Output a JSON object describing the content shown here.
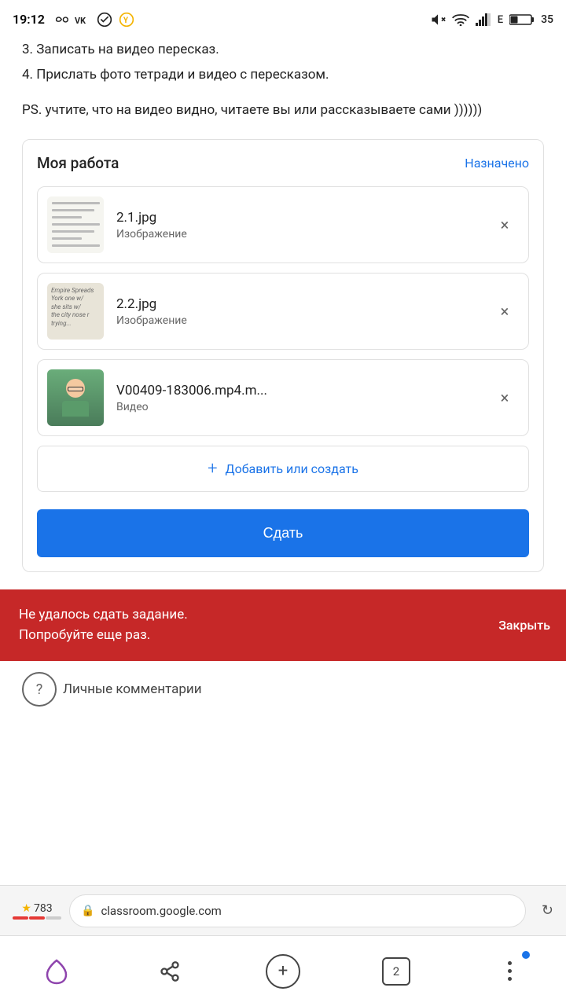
{
  "statusBar": {
    "time": "19:12",
    "battery": "35"
  },
  "taskContent": {
    "line3": "3. Записать на видео пересказ.",
    "line4": "4. Прислать фото тетради и видео с пересказом.",
    "ps": "PS. учтите, что на видео видно, читаете вы или рассказываете сами ))))))"
  },
  "myWork": {
    "title": "Моя работа",
    "status": "Назначено",
    "files": [
      {
        "name": "2.1.jpg",
        "type": "Изображение",
        "kind": "image"
      },
      {
        "name": "2.2.jpg",
        "type": "Изображение",
        "kind": "image2"
      },
      {
        "name": "V00409-183006.mp4.m...",
        "type": "Видео",
        "kind": "video"
      }
    ],
    "addButton": "Добавить или создать",
    "submitButton": "Сдать"
  },
  "errorToast": {
    "message": "Не удалось сдать задание.\nПопробуйте еще раз.",
    "closeLabel": "Закрыть"
  },
  "help": {
    "symbol": "?"
  },
  "comments": {
    "label": "Личные комментарии"
  },
  "browserBar": {
    "score": "783",
    "url": "classroom.google.com",
    "tabCount": "2"
  }
}
